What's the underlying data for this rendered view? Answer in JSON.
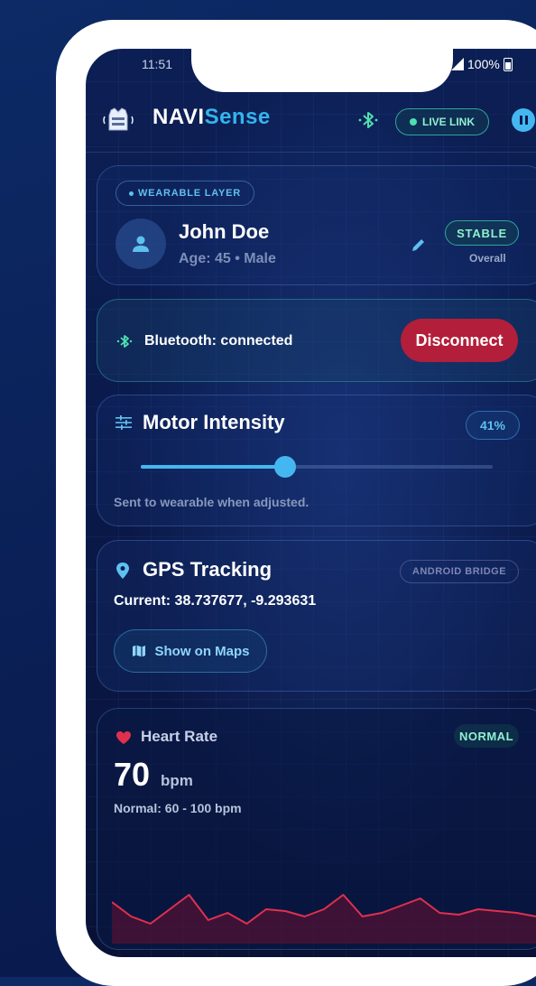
{
  "status_bar": {
    "time": "11:51",
    "battery": "100%"
  },
  "app": {
    "title_navi": "NAVI",
    "title_sense": "Sense",
    "live_link": "LIVE LINK"
  },
  "profile": {
    "layer_label": "WEARABLE LAYER",
    "name": "John Doe",
    "age_gender": "Age: 45  •  Male",
    "status": "STABLE",
    "status_sub": "Overall"
  },
  "bluetooth": {
    "status_text": "Bluetooth: connected",
    "disconnect_label": "Disconnect"
  },
  "motor": {
    "title": "Motor Intensity",
    "percent_label": "41%",
    "value": 41,
    "hint": "Sent to wearable when adjusted."
  },
  "gps": {
    "title": "GPS Tracking",
    "bridge_label": "ANDROID BRIDGE",
    "coords": "Current: 38.737677, -9.293631",
    "maps_label": "Show on Maps"
  },
  "heart": {
    "title": "Heart Rate",
    "status": "NORMAL",
    "value": "70",
    "unit": "bpm",
    "range": "Normal: 60 - 100 bpm",
    "trend": [
      78,
      70,
      66,
      74,
      82,
      68,
      72,
      66,
      74,
      73,
      70,
      74,
      82,
      70,
      72,
      76,
      80,
      72,
      71,
      74,
      73,
      72,
      70
    ],
    "colors": {
      "line": "#e0304e",
      "fill": "#6a1030"
    }
  }
}
